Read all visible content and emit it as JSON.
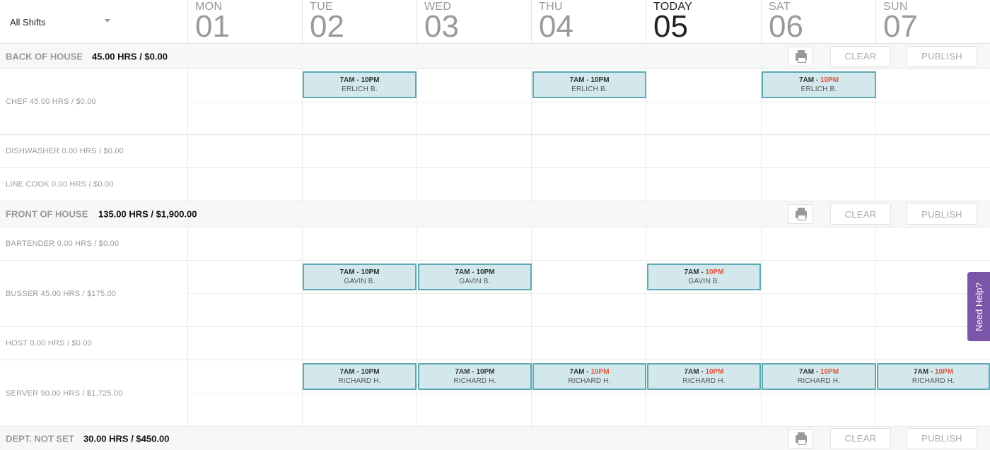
{
  "filter": {
    "label": "All Shifts"
  },
  "days": [
    {
      "name": "MON",
      "num": "01"
    },
    {
      "name": "TUE",
      "num": "02"
    },
    {
      "name": "WED",
      "num": "03"
    },
    {
      "name": "THU",
      "num": "04"
    },
    {
      "name": "TODAY",
      "num": "05"
    },
    {
      "name": "SAT",
      "num": "06"
    },
    {
      "name": "SUN",
      "num": "07"
    }
  ],
  "buttons": {
    "clear": "CLEAR",
    "publish": "PUBLISH"
  },
  "departments": [
    {
      "name": "BACK OF HOUSE",
      "total": "45.00 HRS / $0.00"
    },
    {
      "name": "FRONT OF HOUSE",
      "total": "135.00 HRS / $1,900.00"
    },
    {
      "name": "DEPT. NOT SET",
      "total": "30.00 HRS / $450.00"
    }
  ],
  "roles": [
    {
      "label": "CHEF 45.00 HRS / $0.00"
    },
    {
      "label": "DISHWASHER 0.00 HRS / $0.00"
    },
    {
      "label": "LINE COOK 0.00 HRS / $0.00"
    },
    {
      "label": "BARTENDER 0.00 HRS / $0.00"
    },
    {
      "label": "BUSSER 45.00 HRS / $175.00"
    },
    {
      "label": "HOST 0.00 HRS / $0.00"
    },
    {
      "label": "SERVER 90.00 HRS / $1,725.00"
    }
  ],
  "shifts": [
    {
      "start": "7AM - ",
      "end": "10PM",
      "employee": "ERLICH B."
    },
    {
      "start": "7AM - ",
      "end": "10PM",
      "employee": "ERLICH B."
    },
    {
      "start": "7AM - ",
      "end": "10PM",
      "employee": "ERLICH B."
    },
    {
      "start": "7AM - ",
      "end": "10PM",
      "employee": "GAVIN B."
    },
    {
      "start": "7AM - ",
      "end": "10PM",
      "employee": "GAVIN B."
    },
    {
      "start": "7AM - ",
      "end": "10PM",
      "employee": "GAVIN B."
    },
    {
      "start": "7AM - ",
      "end": "10PM",
      "employee": "RICHARD H."
    },
    {
      "start": "7AM - ",
      "end": "10PM",
      "employee": "RICHARD H."
    },
    {
      "start": "7AM - ",
      "end": "10PM",
      "employee": "RICHARD H."
    },
    {
      "start": "7AM - ",
      "end": "10PM",
      "employee": "RICHARD H."
    },
    {
      "start": "7AM - ",
      "end": "10PM",
      "employee": "RICHARD H."
    },
    {
      "start": "7AM - ",
      "end": "10PM",
      "employee": "RICHARD H."
    }
  ],
  "help": {
    "label": "Need Help?"
  },
  "colors": {
    "shift_bg": "#d3e8ec",
    "shift_border": "#5ea9b3",
    "late_end": "#e0533b",
    "help_tab": "#7a56a8"
  }
}
